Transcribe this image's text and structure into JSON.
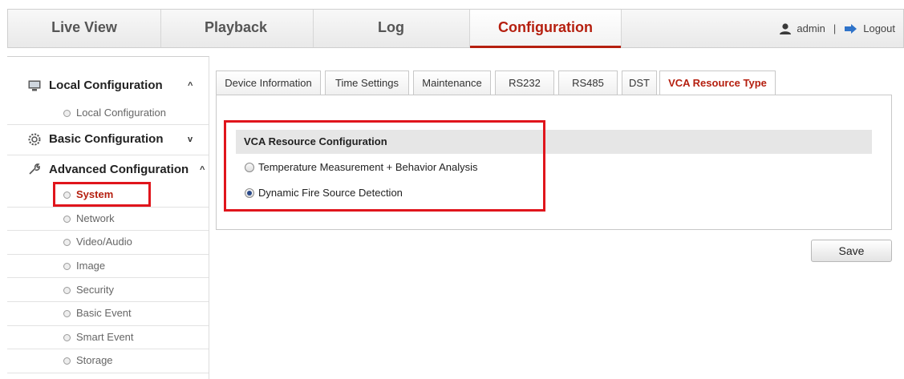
{
  "topnav": {
    "tabs": [
      {
        "label": "Live View"
      },
      {
        "label": "Playback"
      },
      {
        "label": "Log"
      },
      {
        "label": "Configuration"
      }
    ],
    "active_tab": "Configuration",
    "user": {
      "name": "admin",
      "separator": "|",
      "logout_label": "Logout"
    },
    "accent_color": "#b51f0f"
  },
  "sidebar": {
    "sections": [
      {
        "label": "Local Configuration",
        "icon": "monitor-icon",
        "caret": "^",
        "items": [
          {
            "label": "Local Configuration"
          }
        ]
      },
      {
        "label": "Basic Configuration",
        "icon": "gear-icon",
        "caret": "v",
        "items": []
      },
      {
        "label": "Advanced Configuration",
        "icon": "wrench-icon",
        "caret": "^",
        "items": [
          {
            "label": "System"
          },
          {
            "label": "Network"
          },
          {
            "label": "Video/Audio"
          },
          {
            "label": "Image"
          },
          {
            "label": "Security"
          },
          {
            "label": "Basic Event"
          },
          {
            "label": "Smart Event"
          },
          {
            "label": "Storage"
          }
        ]
      }
    ],
    "active_item": "System"
  },
  "subtabs": [
    {
      "label": "Device Information"
    },
    {
      "label": "Time Settings"
    },
    {
      "label": "Maintenance"
    },
    {
      "label": "RS232"
    },
    {
      "label": "RS485"
    },
    {
      "label": "DST"
    },
    {
      "label": "VCA Resource Type"
    }
  ],
  "active_subtab": "VCA Resource Type",
  "vca": {
    "section_title": "VCA Resource Configuration",
    "options": [
      {
        "label": "Temperature Measurement + Behavior Analysis",
        "checked": false
      },
      {
        "label": "Dynamic Fire Source Detection",
        "checked": true
      }
    ]
  },
  "save_label": "Save",
  "highlight_color": "#e0151c"
}
